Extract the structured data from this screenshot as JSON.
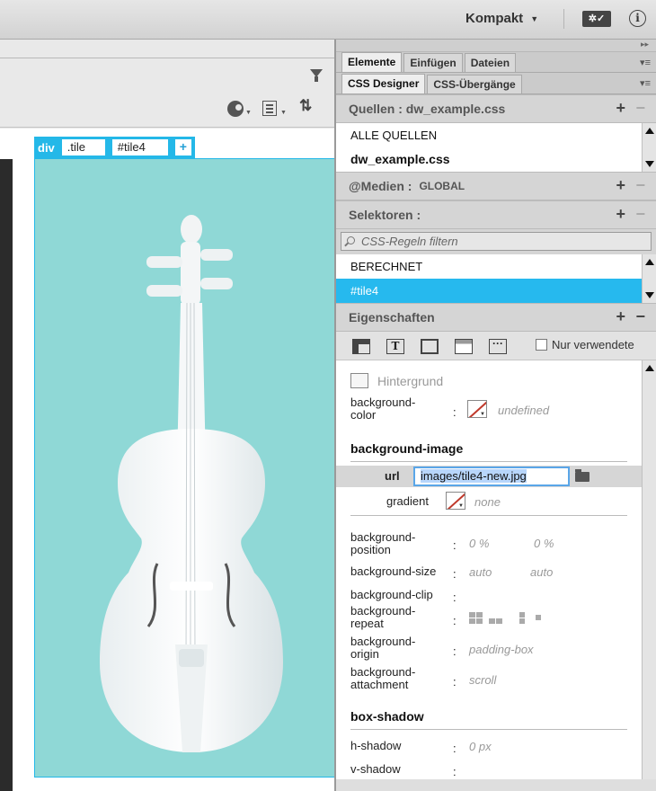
{
  "appbar": {
    "workspace": "Kompakt",
    "sync_icon": "sync-settings-icon",
    "info_icon": "info-icon"
  },
  "doc_toolbar": {
    "icons": [
      "filter-icon",
      "globe-icon",
      "list-icon",
      "sort-icon"
    ]
  },
  "doc": {
    "tag": "div",
    "classes": [
      ".tile",
      "#tile4"
    ],
    "add": "+",
    "tile_color": "#8fd8d6"
  },
  "panel": {
    "tabs_top": [
      "Elemente",
      "Einfügen",
      "Dateien"
    ],
    "tabs_second": [
      "CSS Designer",
      "CSS-Übergänge"
    ],
    "sources": {
      "heading": "Quellen : dw_example.css",
      "items": [
        "ALLE QUELLEN",
        "dw_example.css"
      ]
    },
    "media": {
      "heading": "@Medien :",
      "value": "GLOBAL"
    },
    "selectors": {
      "heading": "Selektoren :",
      "filter_placeholder": "CSS-Regeln filtern",
      "items": [
        "BERECHNET",
        "#tile4"
      ]
    },
    "properties": {
      "heading": "Eigenschaften",
      "only_used": "Nur verwendete",
      "hintergrund": "Hintergrund",
      "bgcolor_label_1": "background-",
      "bgcolor_label_2": "color",
      "bgcolor_value": "undefined",
      "bgimage_heading": "background-image",
      "url_label": "url",
      "url_value": "images/tile4-new.jpg",
      "gradient_label": "gradient",
      "gradient_value": "none",
      "bgpos_label_1": "background-",
      "bgpos_label_2": "position",
      "bgpos_x": "0 %",
      "bgpos_y": "0 %",
      "bgsize_label": "background-size",
      "bgsize_x": "auto",
      "bgsize_y": "auto",
      "bgclip_label": "background-clip",
      "bgrepeat_label_1": "background-",
      "bgrepeat_label_2": "repeat",
      "bgorigin_label_1": "background-",
      "bgorigin_label_2": "origin",
      "bgorigin_value": "padding-box",
      "bgattach_label_1": "background-",
      "bgattach_label_2": "attachment",
      "bgattach_value": "scroll",
      "boxshadow_heading": "box-shadow",
      "hshadow_label": "h-shadow",
      "hshadow_value": "0 px",
      "vshadow_label": "v-shadow"
    },
    "accent": "#26b9ee"
  }
}
